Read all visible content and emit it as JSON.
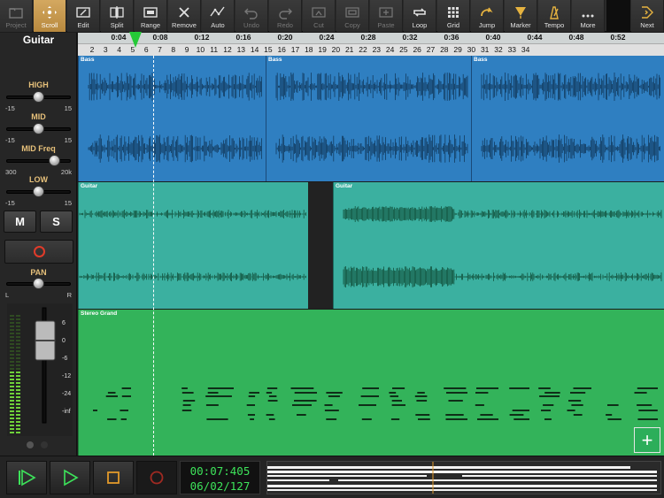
{
  "toolbar": {
    "items": [
      {
        "label": "Project",
        "state": "dim"
      },
      {
        "label": "Scroll",
        "state": "active"
      },
      {
        "label": "Edit",
        "state": "normal"
      },
      {
        "label": "Split",
        "state": "normal"
      },
      {
        "label": "Range",
        "state": "normal"
      },
      {
        "label": "Remove",
        "state": "normal"
      },
      {
        "label": "Auto",
        "state": "normal"
      },
      {
        "label": "Undo",
        "state": "dim"
      },
      {
        "label": "Redo",
        "state": "dim"
      },
      {
        "label": "Cut",
        "state": "dim"
      },
      {
        "label": "Copy",
        "state": "dim"
      },
      {
        "label": "Paste",
        "state": "dim"
      },
      {
        "label": "Loop",
        "state": "normal"
      },
      {
        "label": "Grid",
        "state": "normal"
      },
      {
        "label": "Jump",
        "state": "normal"
      },
      {
        "label": "Marker",
        "state": "normal"
      },
      {
        "label": "Tempo",
        "state": "normal"
      },
      {
        "label": "More",
        "state": "normal"
      },
      {
        "label": "Next",
        "state": "normal"
      }
    ]
  },
  "track_panel": {
    "track_name": "Guitar",
    "eq": {
      "high": {
        "label": "HIGH",
        "min": "-15",
        "max": "15"
      },
      "mid": {
        "label": "MID",
        "min": "-15",
        "max": "15"
      },
      "mid_freq": {
        "label": "MID Freq",
        "min": "300",
        "max": "20k"
      },
      "low": {
        "label": "LOW",
        "min": "-15",
        "max": "15"
      }
    },
    "mute_label": "M",
    "solo_label": "S",
    "pan": {
      "label": "PAN",
      "left": "L",
      "right": "R"
    },
    "fader_scale": [
      "6",
      "0",
      "-6",
      "-12",
      "-24",
      "-inf"
    ]
  },
  "ruler": {
    "times": [
      "0:04",
      "0:08",
      "0:12",
      "0:16",
      "0:20",
      "0:24",
      "0:28",
      "0:32",
      "0:36",
      "0:40",
      "0:44",
      "0:48",
      "0:52"
    ],
    "bars": [
      "2",
      "3",
      "4",
      "5",
      "6",
      "7",
      "8",
      "9",
      "10",
      "11",
      "12",
      "13",
      "14",
      "15",
      "16",
      "17",
      "18",
      "19",
      "20",
      "21",
      "22",
      "23",
      "24",
      "25",
      "26",
      "27",
      "28",
      "29",
      "30",
      "31",
      "32",
      "33",
      "34"
    ]
  },
  "tracks": [
    {
      "name": "Bass",
      "color": "#2f7fc1",
      "clips": [
        "Bass",
        "Bass",
        "Bass"
      ]
    },
    {
      "name": "Guitar",
      "color": "#3bb0a0",
      "clips": [
        "Guitar",
        "Guitar"
      ]
    },
    {
      "name": "Stereo Grand",
      "color": "#33b35a",
      "clips": [
        "Stereo Grand"
      ]
    }
  ],
  "transport": {
    "timecode": "00:07:405",
    "bars_beats": "06/02/127"
  },
  "colors": {
    "accent": "#c99a4d",
    "playhead": "#25c937",
    "record": "#e03b2a",
    "timecode": "#3de35a"
  }
}
